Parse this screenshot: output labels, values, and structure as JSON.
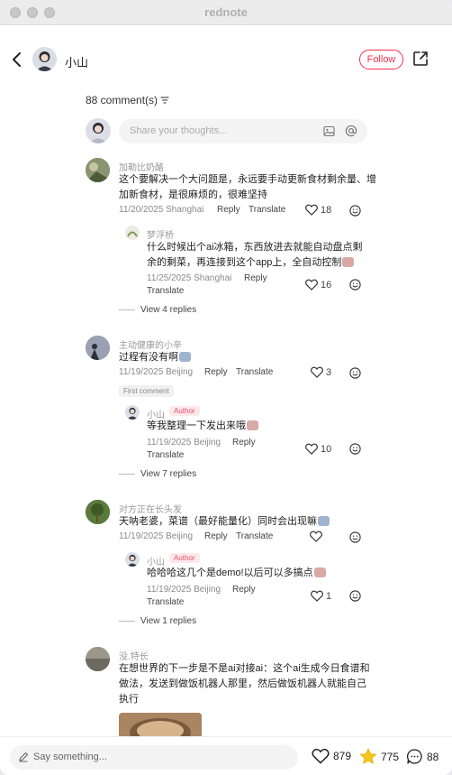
{
  "app": {
    "title": "rednote"
  },
  "header": {
    "user_name": "小山",
    "follow_label": "Follow"
  },
  "comments_section": {
    "count_label": "88 comment(s)",
    "input_placeholder": "Share your thoughts..."
  },
  "comments": [
    {
      "name": "加勒比奶酪",
      "text": "这个要解决一个大问题是，永远要手动更新食材剩余量、增加新食材，是很麻烦的，很难坚持",
      "meta": "11/20/2025 Shanghai",
      "reply": "Reply",
      "translate": "Translate",
      "likes": "18"
    },
    {
      "name": "梦浮桥",
      "text": "什么时候出个ai冰箱，东西放进去就能自动盘点剩余的剩菜，再连接到这个app上，全自动控制",
      "meta": "11/25/2025 Shanghai",
      "reply": "Reply",
      "translate": "Translate",
      "likes": "16"
    },
    {
      "name": "主动健康的小辛",
      "text": "过程有没有啊",
      "meta": "11/19/2025 Beijing",
      "reply": "Reply",
      "translate": "Translate",
      "likes": "3",
      "badge": "First comment"
    },
    {
      "name": "小山",
      "author_badge": "Author",
      "text": "等我整理一下发出来哦",
      "meta": "11/19/2025 Beijing",
      "reply": "Reply",
      "translate": "Translate",
      "likes": "10"
    },
    {
      "name": "对方正在长头发",
      "text": "天呐老婆，菜谱（最好能量化）同时会出现嘛",
      "meta": "11/19/2025 Beijing",
      "reply": "Reply",
      "translate": "Translate",
      "likes": ""
    },
    {
      "name": "小山",
      "author_badge": "Author",
      "text": "哈哈哈这几个是demo!以后可以多搞点",
      "meta": "11/19/2025 Beijing",
      "reply": "Reply",
      "translate": "Translate",
      "likes": "1"
    },
    {
      "name": "没.特长",
      "text": "在想世界的下一步是不是ai对接ai：这个ai生成今日食谱和做法，发送到做饭机器人那里，然后做饭机器人就能自己执行",
      "meta": "",
      "reply": "",
      "translate": "",
      "likes": ""
    }
  ],
  "view_replies": [
    "View 4 replies",
    "View 7 replies",
    "View 1 replies"
  ],
  "bottom_bar": {
    "placeholder": "Say something...",
    "likes": "879",
    "stars": "775",
    "comments": "88"
  },
  "colors": {
    "brand": "#ff2e4d",
    "star": "#f5c518"
  }
}
